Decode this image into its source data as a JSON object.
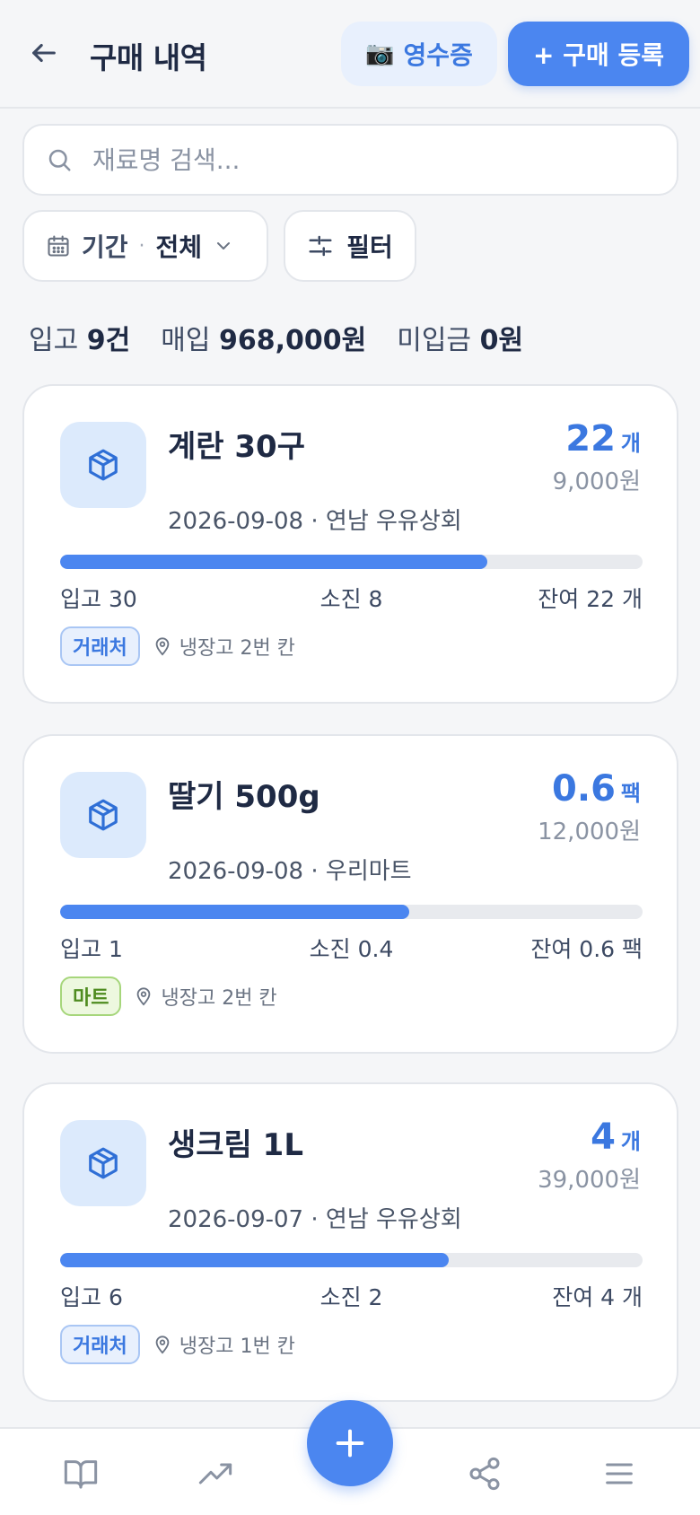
{
  "header": {
    "title": "구매 내역",
    "receipt_icon": "📷",
    "receipt_label": "영수증",
    "register_label": "+ 구매 등록"
  },
  "search": {
    "placeholder": "재료명 검색...",
    "value": ""
  },
  "filters": {
    "period_label": "기간",
    "period_separator": "·",
    "period_value": "전체",
    "filter_label": "필터"
  },
  "summary": {
    "in_label": "입고",
    "in_value": "9건",
    "buy_label": "매입",
    "buy_value": "968,000원",
    "unpaid_label": "미입금",
    "unpaid_value": "0원"
  },
  "purchases": [
    {
      "name": "계란 30구",
      "meta": "2026-09-08 · 연남 우유상회",
      "qty": "22",
      "unit": "개",
      "price": "9,000원",
      "progress": 0.733,
      "stat_in": "입고 30",
      "stat_used": "소진 8",
      "stat_left": "잔여 22 개",
      "tag": "거래처",
      "tag_type": "vendor",
      "location": "냉장고 2번 칸"
    },
    {
      "name": "딸기 500g",
      "meta": "2026-09-08 · 우리마트",
      "qty": "0.6",
      "unit": "팩",
      "price": "12,000원",
      "progress": 0.6,
      "stat_in": "입고 1",
      "stat_used": "소진 0.4",
      "stat_left": "잔여 0.6 팩",
      "tag": "마트",
      "tag_type": "mart",
      "location": "냉장고 2번 칸"
    },
    {
      "name": "생크림 1L",
      "meta": "2026-09-07 · 연남 우유상회",
      "qty": "4",
      "unit": "개",
      "price": "39,000원",
      "progress": 0.667,
      "stat_in": "입고 6",
      "stat_used": "소진 2",
      "stat_left": "잔여 4 개",
      "tag": "거래처",
      "tag_type": "vendor",
      "location": "냉장고 1번 칸"
    }
  ],
  "icons": {
    "back": "back-arrow-icon",
    "search": "search-icon",
    "calendar": "calendar-icon",
    "chevron": "chevron-down-icon",
    "filter": "sliders-icon",
    "package": "package-icon",
    "location": "location-pin-icon",
    "nav": [
      "book-icon",
      "trending-up-icon",
      "plus-icon",
      "share-icon",
      "menu-icon"
    ]
  },
  "colors": {
    "accent": "#4b86f0",
    "accent_text": "#3b78e0",
    "mart_green": "#4e8b1f",
    "background": "#f5f6f8"
  }
}
